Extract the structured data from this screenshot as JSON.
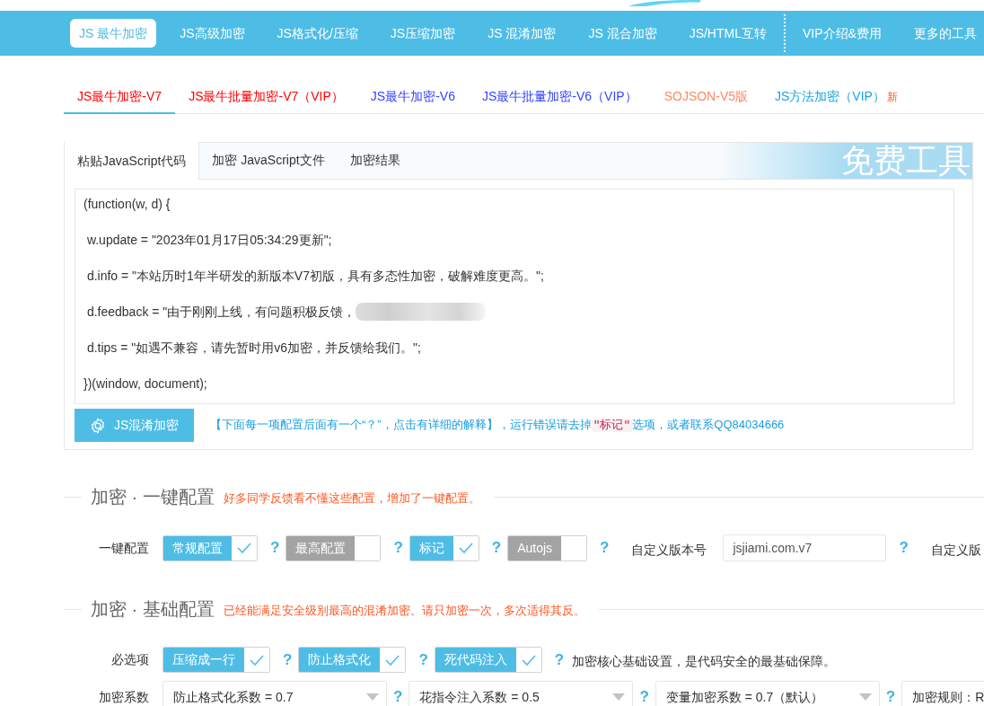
{
  "top_nav": {
    "groups": [
      [
        {
          "label": "JS 最牛加密",
          "selected": true
        },
        {
          "label": "JS高级加密",
          "selected": false
        },
        {
          "label": "JS格式化/压缩",
          "selected": false
        },
        {
          "label": "JS压缩加密",
          "selected": false
        },
        {
          "label": "JS 混淆加密",
          "selected": false
        },
        {
          "label": "JS 混合加密",
          "selected": false
        },
        {
          "label": "JS/HTML互转",
          "selected": false
        }
      ],
      [
        {
          "label": "VIP介绍&费用",
          "selected": false
        },
        {
          "label": "更多的工具",
          "selected": false
        }
      ]
    ]
  },
  "version_tabs": [
    {
      "label": "JS最牛加密-V7",
      "selected": true,
      "color": "#ff0000"
    },
    {
      "label": "JS最牛批量加密-V7（VIP）",
      "selected": false,
      "color": "#ff0000"
    },
    {
      "label": "JS最牛加密-V6",
      "selected": false,
      "color": "#3344ff"
    },
    {
      "label": "JS最牛批量加密-V6（VIP）",
      "selected": false,
      "color": "#3344ff"
    },
    {
      "label": "SOJSON-V5版",
      "selected": false,
      "color": "#ff8866"
    },
    {
      "label": "JS方法加密（VIP）",
      "selected": false,
      "color": "#1aa3e0",
      "badge": "新"
    }
  ],
  "editor_panel": {
    "tabs": [
      {
        "label": "粘贴JavaScript代码",
        "selected": true
      },
      {
        "label": "加密 JavaScript文件",
        "selected": false
      },
      {
        "label": "加密结果",
        "selected": false
      }
    ],
    "banner_text": "免费工具",
    "code_lines": [
      {
        "text": "(function(w, d) {",
        "redacted": false
      },
      {
        "text": " w.update = \"2023年01月17日05:34:29更新\";",
        "redacted": false
      },
      {
        "text": " d.info = \"本站历时1年半研发的新版本V7初版，具有多态性加密，破解难度更高。\";",
        "redacted": false
      },
      {
        "text": " d.feedback = \"由于刚刚上线，有问题积极反馈，",
        "redacted": true
      },
      {
        "text": " d.tips = \"如遇不兼容，请先暂时用v6加密，并反馈给我们。\";",
        "redacted": false
      },
      {
        "text": "})(window, document);",
        "redacted": false
      }
    ],
    "encrypt_button": {
      "label": "JS混淆加密"
    },
    "hint": {
      "before": "【下面每一项配置后面有一个“？”，点击有详细的解释】，运行错误请去掉",
      "code": "\"标记\"",
      "after": "选项，或者联系QQ84034666"
    }
  },
  "sections": [
    {
      "title": "加密 · 一键配置",
      "note": "好多同学反馈看不懂这些配置，增加了一键配置。",
      "rows": [
        {
          "label": "一键配置",
          "items": [
            {
              "kind": "checkbox",
              "text": "常规配置",
              "checked": true
            },
            {
              "kind": "help",
              "text": "?"
            },
            {
              "kind": "checkbox",
              "text": "最高配置",
              "checked": false
            },
            {
              "kind": "help",
              "text": "?"
            },
            {
              "kind": "checkbox",
              "text": "标记",
              "checked": true
            },
            {
              "kind": "help",
              "text": "?"
            },
            {
              "kind": "checkbox",
              "text": "Autojs",
              "checked": false
            },
            {
              "kind": "help",
              "text": "?"
            },
            {
              "kind": "label",
              "text": "自定义版本号"
            },
            {
              "kind": "input",
              "value": "jsjiami.com.v7"
            },
            {
              "kind": "help",
              "text": "?"
            },
            {
              "kind": "label",
              "text": "自定义版"
            }
          ]
        }
      ]
    },
    {
      "title": "加密 · 基础配置",
      "note": "已经能满足安全级别最高的混淆加密。请只加密一次，多次适得其反。",
      "rows": [
        {
          "label": "必选项",
          "items": [
            {
              "kind": "checkbox",
              "text": "压缩成一行",
              "checked": true
            },
            {
              "kind": "help",
              "text": "?"
            },
            {
              "kind": "checkbox",
              "text": "防止格式化",
              "checked": true
            },
            {
              "kind": "help",
              "text": "?"
            },
            {
              "kind": "checkbox",
              "text": "死代码注入",
              "checked": true
            },
            {
              "kind": "help",
              "text": "?"
            },
            {
              "kind": "text",
              "text": "加密核心基础设置，是代码安全的最基础保障。"
            }
          ]
        },
        {
          "label": "加密系数",
          "items": [
            {
              "kind": "select",
              "text": "防止格式化系数 = 0.7"
            },
            {
              "kind": "help",
              "text": "?"
            },
            {
              "kind": "select",
              "text": "花指令注入系数 = 0.5"
            },
            {
              "kind": "help",
              "text": "?"
            },
            {
              "kind": "select",
              "text": "变量加密系数 = 0.7（默认）"
            },
            {
              "kind": "help",
              "text": "?"
            },
            {
              "kind": "select",
              "text": "加密规则：R"
            }
          ]
        }
      ]
    }
  ]
}
